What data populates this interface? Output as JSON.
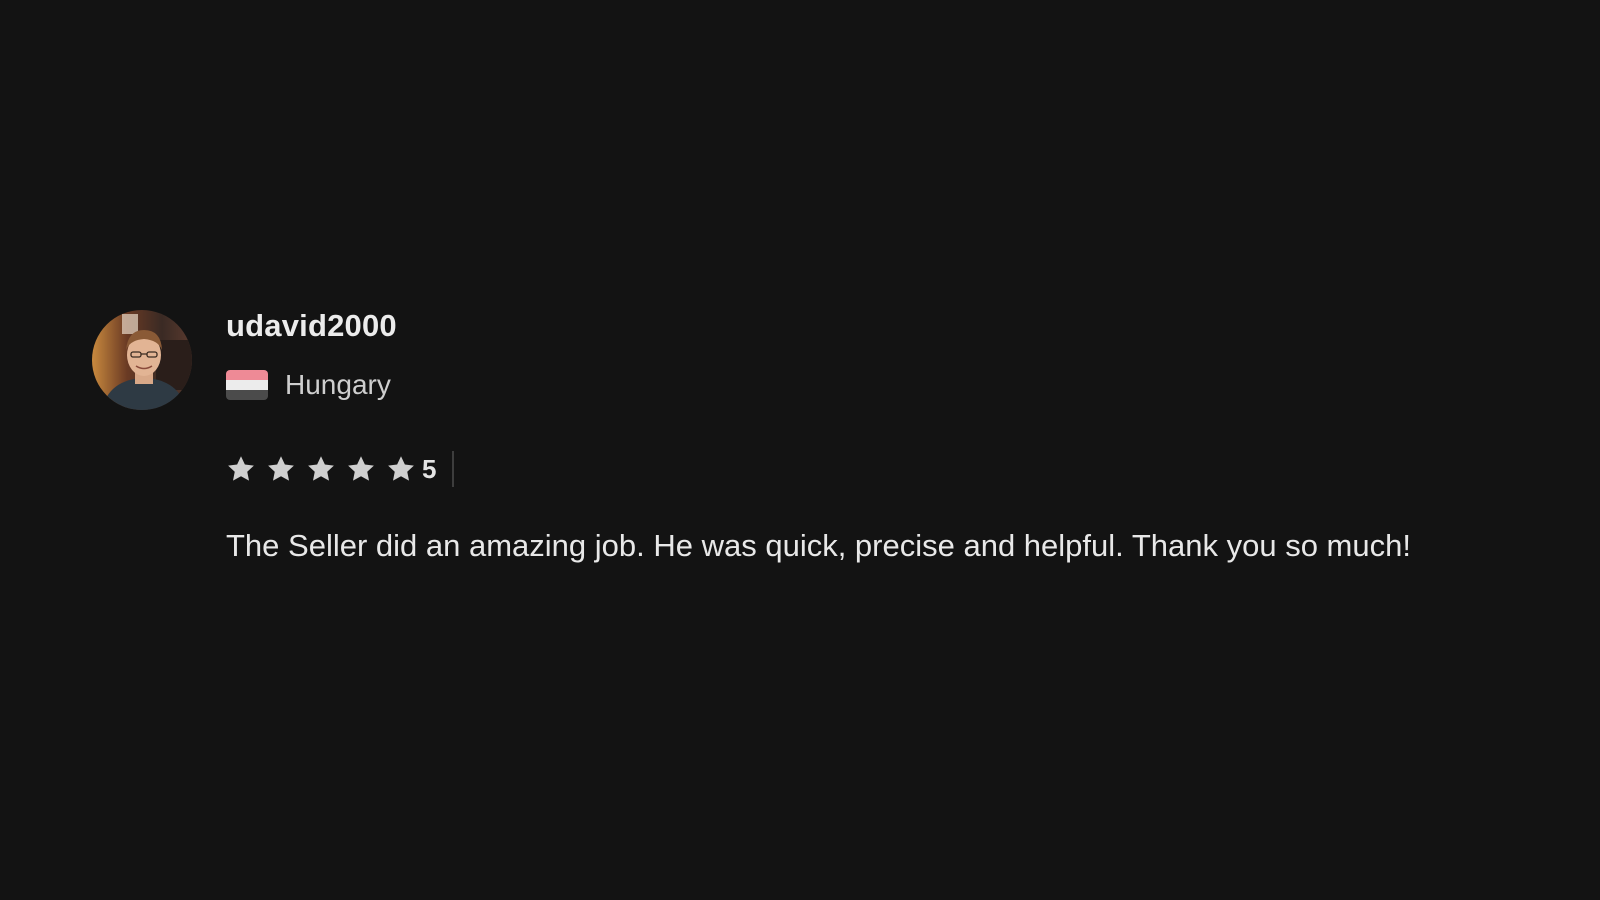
{
  "review": {
    "avatar_icon": "user-avatar-photo",
    "username": "udavid2000",
    "country": {
      "name": "Hungary",
      "flag_icon": "hungary-flag-icon",
      "flag_colors": [
        "#ee8a96",
        "#ececec",
        "#4b4b4b"
      ]
    },
    "rating": {
      "value": "5",
      "max": 5,
      "filled": 5,
      "star_icon": "star-icon",
      "star_color": "#cfcfcf"
    },
    "text": "The Seller did an amazing job. He was quick, precise and helpful. Thank you so much!"
  }
}
